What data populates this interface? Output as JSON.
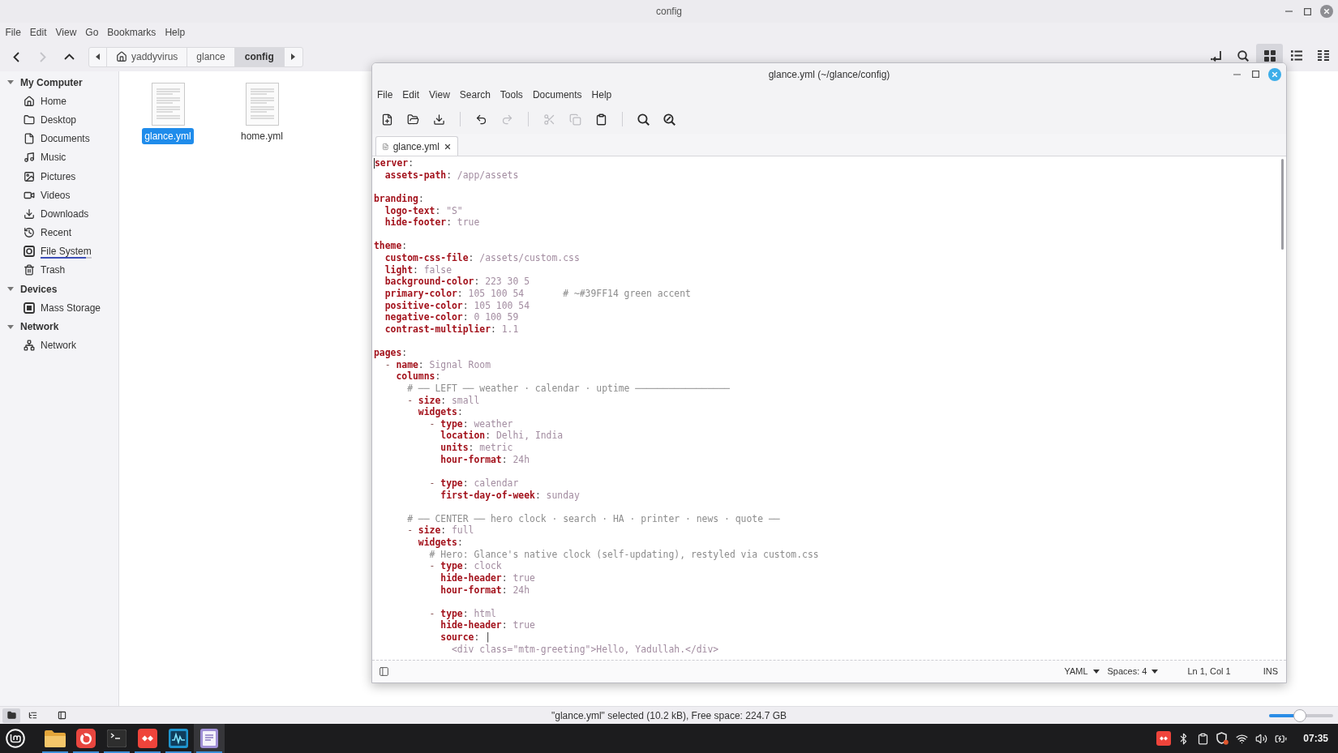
{
  "file_manager": {
    "window": {
      "title": "config"
    },
    "menu": [
      "File",
      "Edit",
      "View",
      "Go",
      "Bookmarks",
      "Help"
    ],
    "nav_buttons": [
      {
        "kind": "back",
        "disabled": false
      },
      {
        "kind": "forward",
        "disabled": true
      },
      {
        "kind": "up",
        "disabled": false
      }
    ],
    "path_bar": [
      {
        "kind": "home",
        "label": "yaddyvirus",
        "selected": false
      },
      {
        "kind": "folder",
        "label": "glance",
        "selected": false
      },
      {
        "kind": "folder",
        "label": "config",
        "selected": true
      }
    ],
    "view_buttons": [
      {
        "kind": "location",
        "selected": false
      },
      {
        "kind": "search",
        "selected": false
      },
      {
        "kind": "icons",
        "selected": true
      },
      {
        "kind": "list",
        "selected": false
      },
      {
        "kind": "compact",
        "selected": false
      }
    ],
    "sidebar": {
      "sections": [
        {
          "title": "My Computer",
          "expanded": true,
          "items": [
            {
              "kind": "home",
              "label": "Home"
            },
            {
              "kind": "folder",
              "label": "Desktop"
            },
            {
              "kind": "document",
              "label": "Documents"
            },
            {
              "kind": "music",
              "label": "Music"
            },
            {
              "kind": "pictures",
              "label": "Pictures"
            },
            {
              "kind": "videos",
              "label": "Videos"
            },
            {
              "kind": "downloads",
              "label": "Downloads"
            },
            {
              "kind": "recent",
              "label": "Recent"
            },
            {
              "kind": "drive",
              "label": "File System",
              "level": 0.9
            },
            {
              "kind": "trash",
              "label": "Trash"
            }
          ]
        },
        {
          "title": "Devices",
          "expanded": true,
          "items": [
            {
              "kind": "storage",
              "label": "Mass Storage"
            }
          ]
        },
        {
          "title": "Network",
          "expanded": true,
          "items": [
            {
              "kind": "network",
              "label": "Network"
            }
          ]
        }
      ]
    },
    "files": [
      {
        "name": "glance.yml",
        "selected": true
      },
      {
        "name": "home.yml",
        "selected": false
      }
    ],
    "status_bar": {
      "sidebar_modes": [
        {
          "kind": "places",
          "selected": true
        },
        {
          "kind": "tree",
          "selected": false
        }
      ],
      "text": "\"glance.yml\" selected (10.2 kB), Free space: 224.7 GB",
      "zoom": {
        "level": 0.48
      }
    }
  },
  "editor": {
    "window": {
      "title": "glance.yml (~/glance/config)"
    },
    "menu": [
      "File",
      "Edit",
      "View",
      "Search",
      "Tools",
      "Documents",
      "Help"
    ],
    "toolbar": [
      {
        "kind": "new",
        "disabled": false
      },
      {
        "kind": "open",
        "disabled": false
      },
      {
        "kind": "save",
        "disabled": false
      },
      {
        "kind": "separator"
      },
      {
        "kind": "undo",
        "disabled": false
      },
      {
        "kind": "redo",
        "disabled": true
      },
      {
        "kind": "separator"
      },
      {
        "kind": "cut",
        "disabled": true
      },
      {
        "kind": "copy",
        "disabled": true
      },
      {
        "kind": "paste",
        "disabled": false
      },
      {
        "kind": "separator"
      },
      {
        "kind": "find",
        "disabled": false
      },
      {
        "kind": "replace",
        "disabled": false
      }
    ],
    "tabs": [
      {
        "label": "glance.yml",
        "selected": true
      }
    ],
    "lines": [
      {
        "kind": "line",
        "tokens": [
          {
            "kind": "key",
            "text": "server"
          },
          {
            "kind": "colon",
            "text": ":"
          }
        ],
        "children": [
          {
            "kind": "line",
            "tokens": [
              {
                "kind": "key",
                "text": "assets-path"
              },
              {
                "kind": "colon",
                "text": ":"
              },
              {
                "kind": "value",
                "text": "/app/assets"
              }
            ]
          }
        ]
      },
      {
        "kind": "blank"
      },
      {
        "kind": "line",
        "tokens": [
          {
            "kind": "key",
            "text": "branding"
          },
          {
            "kind": "colon",
            "text": ":"
          }
        ],
        "children": [
          {
            "kind": "line",
            "tokens": [
              {
                "kind": "key",
                "text": "logo-text"
              },
              {
                "kind": "colon",
                "text": ":"
              },
              {
                "kind": "value",
                "text": "\"S\""
              }
            ]
          },
          {
            "kind": "line",
            "tokens": [
              {
                "kind": "key",
                "text": "hide-footer"
              },
              {
                "kind": "colon",
                "text": ":"
              },
              {
                "kind": "value",
                "text": "true"
              }
            ]
          }
        ]
      },
      {
        "kind": "blank"
      },
      {
        "kind": "line",
        "tokens": [
          {
            "kind": "key",
            "text": "theme"
          },
          {
            "kind": "colon",
            "text": ":"
          }
        ],
        "children": [
          {
            "kind": "line",
            "tokens": [
              {
                "kind": "key",
                "text": "custom-css-file"
              },
              {
                "kind": "colon",
                "text": ":"
              },
              {
                "kind": "value",
                "text": "/assets/custom.css"
              }
            ]
          },
          {
            "kind": "line",
            "tokens": [
              {
                "kind": "key",
                "text": "light"
              },
              {
                "kind": "colon",
                "text": ":"
              },
              {
                "kind": "value",
                "text": "false"
              }
            ]
          },
          {
            "kind": "line",
            "tokens": [
              {
                "kind": "key",
                "text": "background-color"
              },
              {
                "kind": "colon",
                "text": ":"
              },
              {
                "kind": "value",
                "text": "223 30 5"
              }
            ]
          },
          {
            "kind": "line",
            "tokens": [
              {
                "kind": "key",
                "text": "primary-color"
              },
              {
                "kind": "colon",
                "text": ":"
              },
              {
                "kind": "value",
                "text": "105 100 54"
              },
              {
                "kind": "comment",
                "text": "# ~#39FF14 green accent"
              }
            ]
          },
          {
            "kind": "line",
            "tokens": [
              {
                "kind": "key",
                "text": "positive-color"
              },
              {
                "kind": "colon",
                "text": ":"
              },
              {
                "kind": "value",
                "text": "105 100 54"
              }
            ]
          },
          {
            "kind": "line",
            "tokens": [
              {
                "kind": "key",
                "text": "negative-color"
              },
              {
                "kind": "colon",
                "text": ":"
              },
              {
                "kind": "value",
                "text": "0 100 59"
              }
            ]
          },
          {
            "kind": "line",
            "tokens": [
              {
                "kind": "key",
                "text": "contrast-multiplier"
              },
              {
                "kind": "colon",
                "text": ":"
              },
              {
                "kind": "value",
                "text": "1.1"
              }
            ]
          }
        ]
      },
      {
        "kind": "blank"
      },
      {
        "kind": "line",
        "tokens": [
          {
            "kind": "key",
            "text": "pages"
          },
          {
            "kind": "colon",
            "text": ":"
          }
        ],
        "children": [
          {
            "kind": "line",
            "tokens": [
              {
                "kind": "dash",
                "text": "-"
              },
              {
                "kind": "key",
                "text": "name"
              },
              {
                "kind": "colon",
                "text": ":"
              },
              {
                "kind": "value",
                "text": "Signal Room"
              }
            ],
            "children": [
              {
                "kind": "line",
                "tokens": [
                  {
                    "kind": "key",
                    "text": "columns"
                  },
                  {
                    "kind": "colon",
                    "text": ":"
                  }
                ],
                "children": [
                  {
                    "kind": "line",
                    "tokens": [
                      {
                        "kind": "comment",
                        "text": "# ── LEFT ── weather · calendar · uptime ─────────────────"
                      }
                    ]
                  },
                  {
                    "kind": "line",
                    "tokens": [
                      {
                        "kind": "dash",
                        "text": "-"
                      },
                      {
                        "kind": "key",
                        "text": "size"
                      },
                      {
                        "kind": "colon",
                        "text": ":"
                      },
                      {
                        "kind": "value",
                        "text": "small"
                      }
                    ],
                    "children": [
                      {
                        "kind": "line",
                        "tokens": [
                          {
                            "kind": "key",
                            "text": "widgets"
                          },
                          {
                            "kind": "colon",
                            "text": ":"
                          }
                        ],
                        "children": [
                          {
                            "kind": "line",
                            "tokens": [
                              {
                                "kind": "dash",
                                "text": "-"
                              },
                              {
                                "kind": "key",
                                "text": "type"
                              },
                              {
                                "kind": "colon",
                                "text": ":"
                              },
                              {
                                "kind": "value",
                                "text": "weather"
                              }
                            ],
                            "children": [
                              {
                                "kind": "line",
                                "tokens": [
                                  {
                                    "kind": "key",
                                    "text": "location"
                                  },
                                  {
                                    "kind": "colon",
                                    "text": ":"
                                  },
                                  {
                                    "kind": "value",
                                    "text": "Delhi, India"
                                  }
                                ]
                              },
                              {
                                "kind": "line",
                                "tokens": [
                                  {
                                    "kind": "key",
                                    "text": "units"
                                  },
                                  {
                                    "kind": "colon",
                                    "text": ":"
                                  },
                                  {
                                    "kind": "value",
                                    "text": "metric"
                                  }
                                ]
                              },
                              {
                                "kind": "line",
                                "tokens": [
                                  {
                                    "kind": "key",
                                    "text": "hour-format"
                                  },
                                  {
                                    "kind": "colon",
                                    "text": ":"
                                  },
                                  {
                                    "kind": "value",
                                    "text": "24h"
                                  }
                                ]
                              }
                            ]
                          },
                          {
                            "kind": "blank"
                          },
                          {
                            "kind": "line",
                            "tokens": [
                              {
                                "kind": "dash",
                                "text": "-"
                              },
                              {
                                "kind": "key",
                                "text": "type"
                              },
                              {
                                "kind": "colon",
                                "text": ":"
                              },
                              {
                                "kind": "value",
                                "text": "calendar"
                              }
                            ],
                            "children": [
                              {
                                "kind": "line",
                                "tokens": [
                                  {
                                    "kind": "key",
                                    "text": "first-day-of-week"
                                  },
                                  {
                                    "kind": "colon",
                                    "text": ":"
                                  },
                                  {
                                    "kind": "value",
                                    "text": "sunday"
                                  }
                                ]
                              }
                            ]
                          }
                        ]
                      }
                    ]
                  },
                  {
                    "kind": "blank"
                  },
                  {
                    "kind": "line",
                    "tokens": [
                      {
                        "kind": "comment",
                        "text": "# ── CENTER ── hero clock · search · HA · printer · news · quote ──"
                      }
                    ]
                  },
                  {
                    "kind": "line",
                    "tokens": [
                      {
                        "kind": "dash",
                        "text": "-"
                      },
                      {
                        "kind": "key",
                        "text": "size"
                      },
                      {
                        "kind": "colon",
                        "text": ":"
                      },
                      {
                        "kind": "value",
                        "text": "full"
                      }
                    ],
                    "children": [
                      {
                        "kind": "line",
                        "tokens": [
                          {
                            "kind": "key",
                            "text": "widgets"
                          },
                          {
                            "kind": "colon",
                            "text": ":"
                          }
                        ],
                        "children": [
                          {
                            "kind": "line",
                            "tokens": [
                              {
                                "kind": "comment",
                                "text": "# Hero: Glance's native clock (self-updating), restyled via custom.css"
                              }
                            ]
                          },
                          {
                            "kind": "line",
                            "tokens": [
                              {
                                "kind": "dash",
                                "text": "-"
                              },
                              {
                                "kind": "key",
                                "text": "type"
                              },
                              {
                                "kind": "colon",
                                "text": ":"
                              },
                              {
                                "kind": "value",
                                "text": "clock"
                              }
                            ],
                            "children": [
                              {
                                "kind": "line",
                                "tokens": [
                                  {
                                    "kind": "key",
                                    "text": "hide-header"
                                  },
                                  {
                                    "kind": "colon",
                                    "text": ":"
                                  },
                                  {
                                    "kind": "value",
                                    "text": "true"
                                  }
                                ]
                              },
                              {
                                "kind": "line",
                                "tokens": [
                                  {
                                    "kind": "key",
                                    "text": "hour-format"
                                  },
                                  {
                                    "kind": "colon",
                                    "text": ":"
                                  },
                                  {
                                    "kind": "value",
                                    "text": "24h"
                                  }
                                ]
                              }
                            ]
                          },
                          {
                            "kind": "blank"
                          },
                          {
                            "kind": "line",
                            "tokens": [
                              {
                                "kind": "dash",
                                "text": "-"
                              },
                              {
                                "kind": "key",
                                "text": "type"
                              },
                              {
                                "kind": "colon",
                                "text": ":"
                              },
                              {
                                "kind": "value",
                                "text": "html"
                              }
                            ],
                            "children": [
                              {
                                "kind": "line",
                                "tokens": [
                                  {
                                    "kind": "key",
                                    "text": "hide-header"
                                  },
                                  {
                                    "kind": "colon",
                                    "text": ":"
                                  },
                                  {
                                    "kind": "value",
                                    "text": "true"
                                  }
                                ]
                              },
                              {
                                "kind": "line",
                                "tokens": [
                                  {
                                    "kind": "key",
                                    "text": "source"
                                  },
                                  {
                                    "kind": "colon",
                                    "text": ":"
                                  },
                                  {
                                    "kind": "pipe",
                                    "text": "|"
                                  }
                                ],
                                "children": [
                                  {
                                    "kind": "line",
                                    "tokens": [
                                      {
                                        "kind": "value",
                                        "text": "<div class=\"mtm-greeting\">Hello, Yadullah.</div>"
                                      }
                                    ]
                                  }
                                ]
                              }
                            ]
                          }
                        ]
                      }
                    ]
                  }
                ]
              }
            ]
          }
        ]
      }
    ],
    "status_bar": [
      {
        "kind": "dropdown",
        "label": "YAML"
      },
      {
        "kind": "dropdown",
        "label": "Spaces: 4"
      },
      {
        "kind": "text",
        "label": "Ln 1, Col 1"
      },
      {
        "kind": "text",
        "label": "INS"
      }
    ]
  },
  "taskbar": {
    "apps": [
      {
        "kind": "start_menu"
      },
      {
        "kind": "files",
        "running": true,
        "selected": false
      },
      {
        "kind": "browser",
        "running": true,
        "selected": false
      },
      {
        "kind": "terminal",
        "running": true,
        "selected": false
      },
      {
        "kind": "remote_desktop",
        "running": true,
        "selected": false
      },
      {
        "kind": "monitor",
        "running": true,
        "selected": false
      },
      {
        "kind": "text_editor",
        "running": true,
        "selected": true
      }
    ],
    "tray": [
      {
        "kind": "remote_desktop"
      },
      {
        "kind": "bluetooth"
      },
      {
        "kind": "clipboard"
      },
      {
        "kind": "shield"
      },
      {
        "kind": "wifi"
      },
      {
        "kind": "volume"
      },
      {
        "kind": "battery"
      }
    ],
    "clock": "07:35"
  }
}
